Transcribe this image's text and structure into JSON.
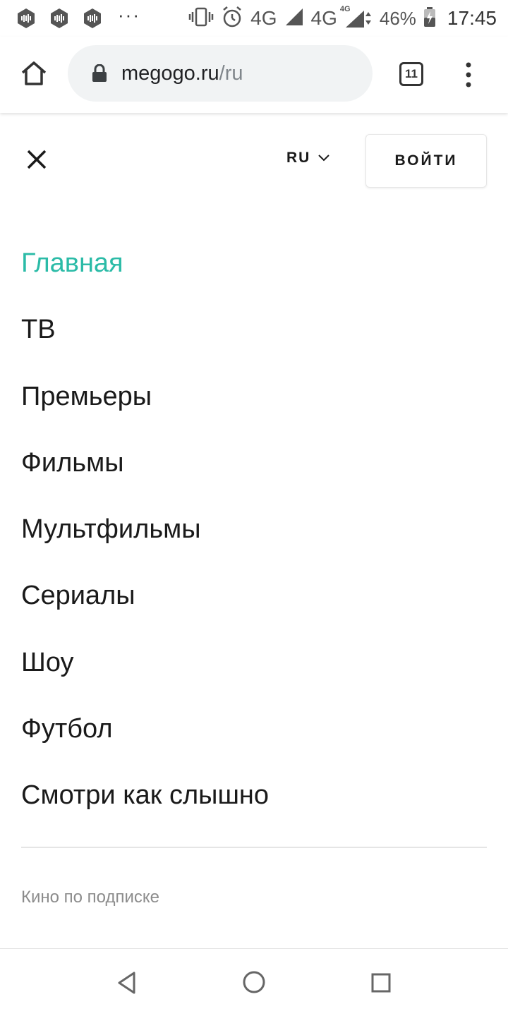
{
  "status_bar": {
    "network_1": "4G",
    "network_2": "4G",
    "network_2_badge": "4G",
    "battery_percent": "46%",
    "time": "17:45",
    "overflow": "···"
  },
  "browser": {
    "url_host": "megogo.ru",
    "url_path": "/ru",
    "tab_count": "11"
  },
  "site_header": {
    "language": "RU",
    "login_label": "ВОЙТИ"
  },
  "menu": {
    "items": [
      {
        "label": "Главная",
        "active": true
      },
      {
        "label": "ТВ"
      },
      {
        "label": "Премьеры"
      },
      {
        "label": "Фильмы"
      },
      {
        "label": "Мультфильмы"
      },
      {
        "label": "Сериалы"
      },
      {
        "label": "Шоу"
      },
      {
        "label": "Футбол"
      },
      {
        "label": "Смотри как слышно"
      }
    ],
    "section_heading": "Кино по подписке"
  },
  "colors": {
    "accent": "#2bbba7",
    "text": "#1a1a1a",
    "muted": "#8c8c8c"
  }
}
